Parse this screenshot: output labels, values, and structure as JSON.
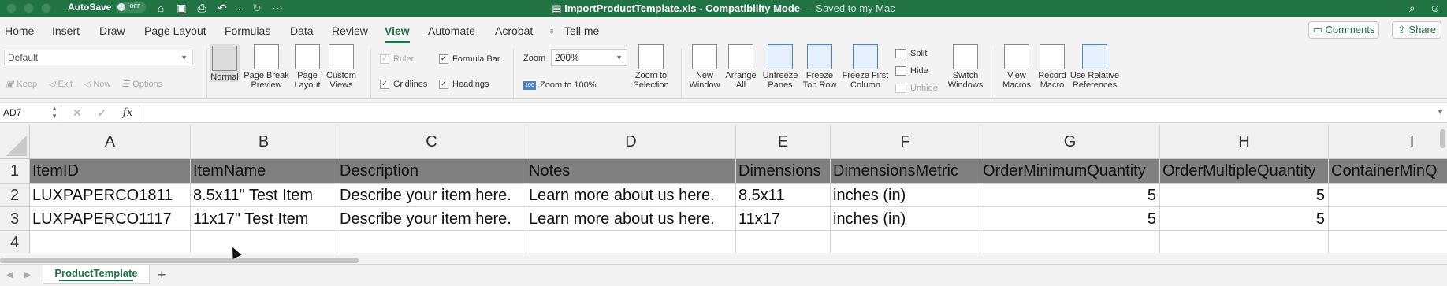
{
  "titlebar": {
    "autosave_label": "AutoSave",
    "autosave_state": "OFF",
    "doc_name": "ImportProductTemplate.xls",
    "mode": "Compatibility Mode",
    "saved_status": "— Saved to my Mac"
  },
  "tabs": [
    "Home",
    "Insert",
    "Draw",
    "Page Layout",
    "Formulas",
    "Data",
    "Review",
    "View",
    "Automate",
    "Acrobat"
  ],
  "active_tab": "View",
  "tell_me": "Tell me",
  "comments_label": "Comments",
  "share_label": "Share",
  "ribbon": {
    "sheet_view_value": "Default",
    "sheet_view_buttons": [
      "Keep",
      "Exit",
      "New",
      "Options"
    ],
    "views": [
      {
        "label1": "Normal",
        "label2": ""
      },
      {
        "label1": "Page Break",
        "label2": "Preview"
      },
      {
        "label1": "Page",
        "label2": "Layout"
      },
      {
        "label1": "Custom",
        "label2": "Views"
      }
    ],
    "show": {
      "ruler": "Ruler",
      "formula_bar": "Formula Bar",
      "gridlines": "Gridlines",
      "headings": "Headings"
    },
    "zoom_label": "Zoom",
    "zoom_value": "200%",
    "zoom_100": "Zoom to 100%",
    "zoom_sel": {
      "label1": "Zoom to",
      "label2": "Selection"
    },
    "window": [
      {
        "label1": "New",
        "label2": "Window"
      },
      {
        "label1": "Arrange",
        "label2": "All"
      },
      {
        "label1": "Unfreeze",
        "label2": "Panes"
      },
      {
        "label1": "Freeze",
        "label2": "Top Row"
      },
      {
        "label1": "Freeze First",
        "label2": "Column"
      }
    ],
    "split": "Split",
    "hide": "Hide",
    "unhide": "Unhide",
    "switch": {
      "label1": "Switch",
      "label2": "Windows"
    },
    "macros": [
      {
        "label1": "View",
        "label2": "Macros"
      },
      {
        "label1": "Record",
        "label2": "Macro"
      },
      {
        "label1": "Use Relative",
        "label2": "References"
      }
    ]
  },
  "formula_bar": {
    "name_box": "AD7",
    "fx": "fx",
    "content": ""
  },
  "columns": [
    "A",
    "B",
    "C",
    "D",
    "E",
    "F",
    "G",
    "H",
    "I"
  ],
  "rows": [
    "1",
    "2",
    "3",
    "4"
  ],
  "cells": {
    "r1": [
      "ItemID",
      "ItemName",
      "Description",
      "Notes",
      "Dimensions",
      "DimensionsMetric",
      "OrderMinimumQuantity",
      "OrderMultipleQuantity",
      "ContainerMinQ"
    ],
    "r2": [
      "LUXPAPERCO1811",
      "8.5x11\" Test Item",
      "Describe your item here.",
      "Learn more about us here.",
      "8.5x11",
      "inches (in)",
      "5",
      "5",
      ""
    ],
    "r3": [
      "LUXPAPERCO1117",
      "11x17\" Test Item",
      "Describe your item here.",
      "Learn more about us here.",
      "11x17",
      "inches (in)",
      "5",
      "5",
      ""
    ],
    "r4": [
      "",
      "",
      "",
      "",
      "",
      "",
      "",
      "",
      ""
    ]
  },
  "sheet_tab": "ProductTemplate",
  "colors": {
    "accent": "#217346",
    "header_fill": "#808080"
  }
}
